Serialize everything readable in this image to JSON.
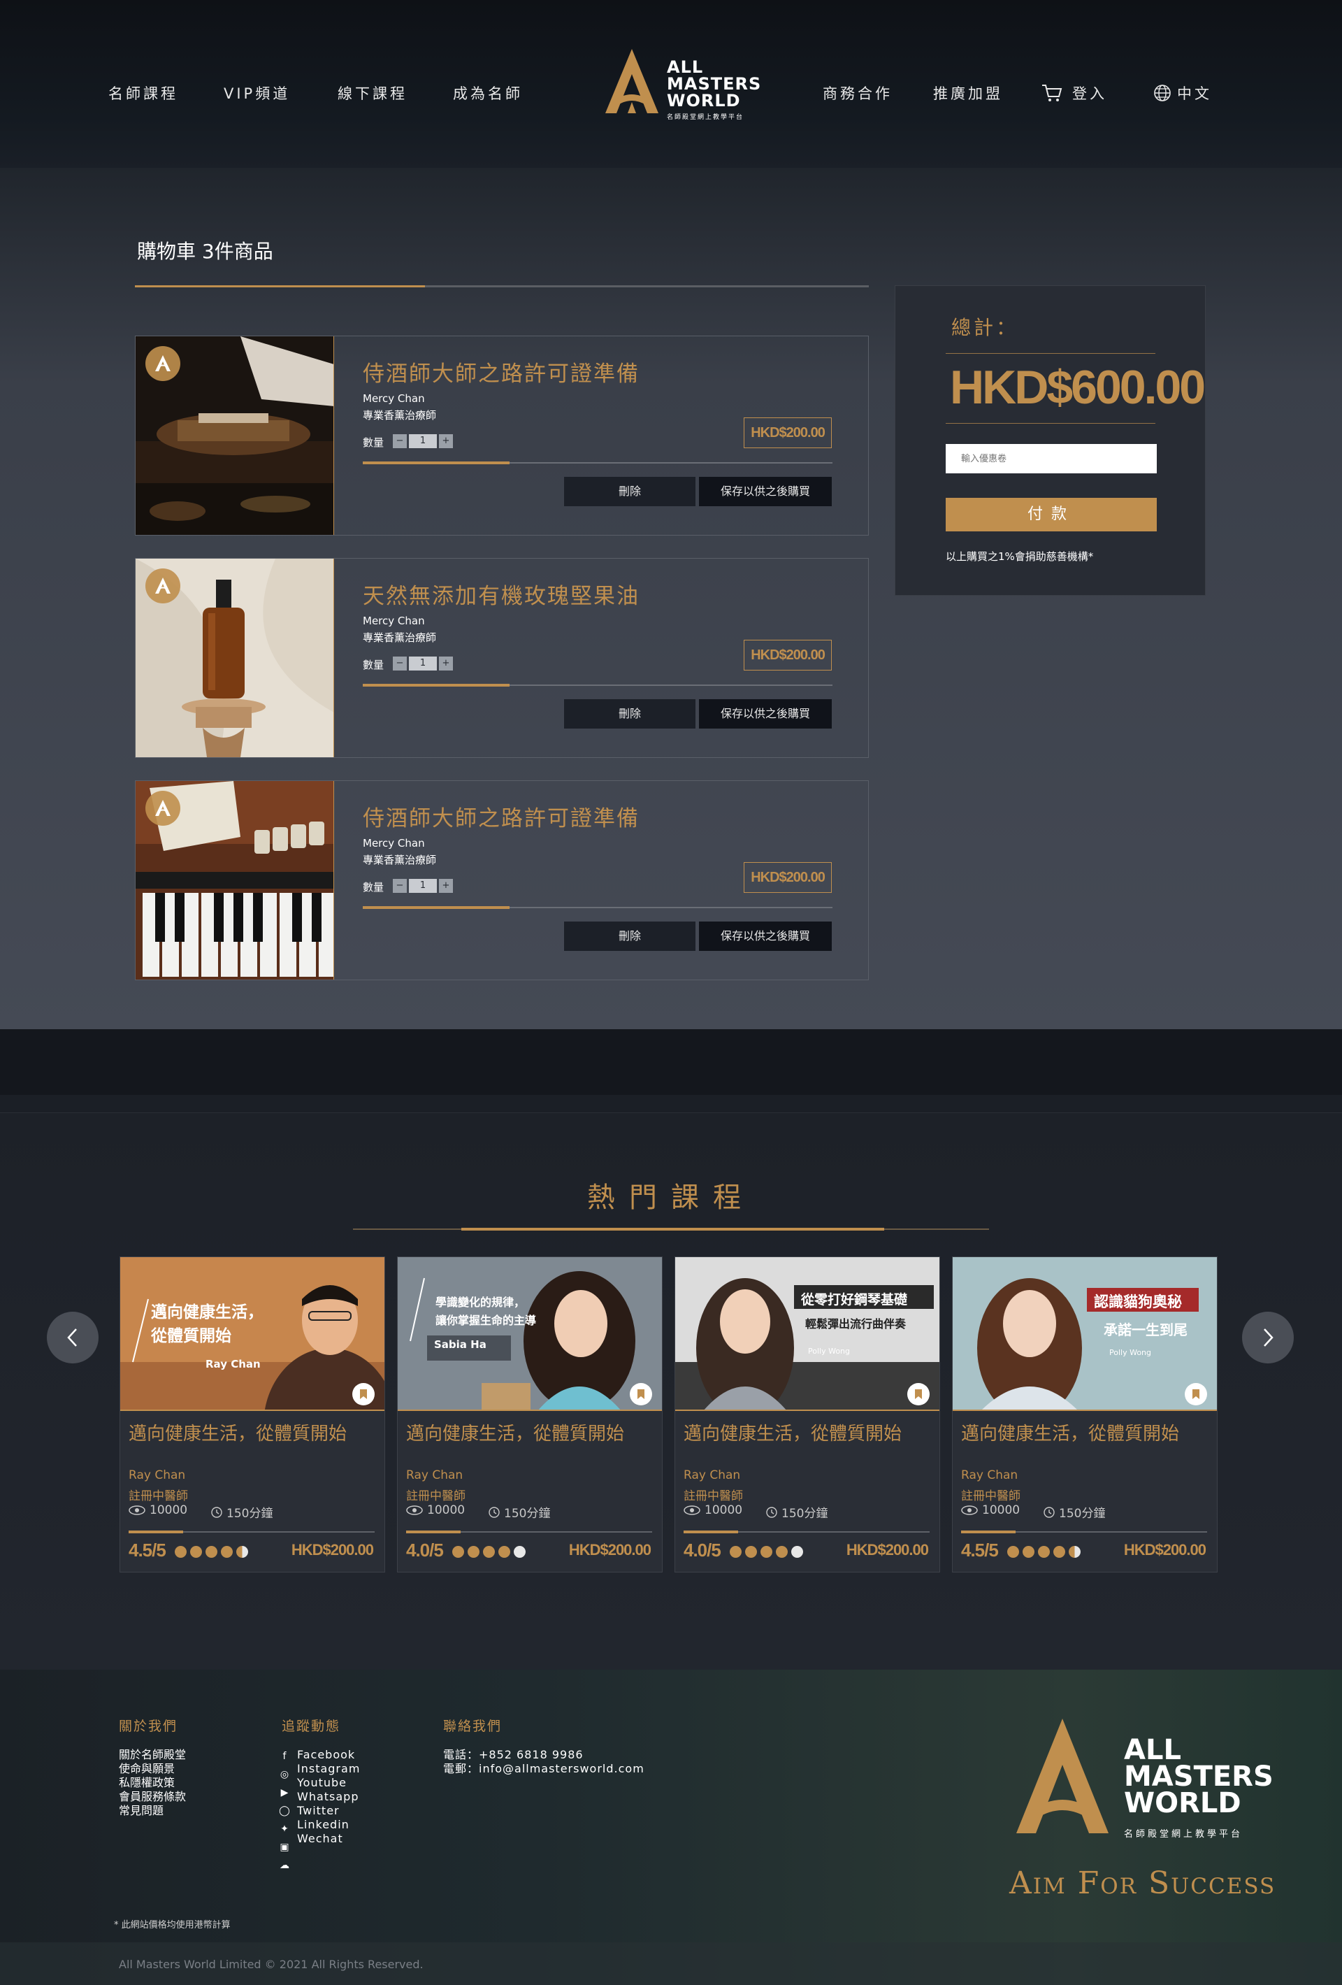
{
  "nav": {
    "left": [
      "名師課程",
      "VIP頻道",
      "線下課程",
      "成為名師"
    ],
    "right": [
      "商務合作",
      "推廣加盟"
    ],
    "login": "登入",
    "language": "中文"
  },
  "logo": {
    "line1": "ALL",
    "line2": "MASTERS",
    "line3": "WORLD",
    "sub": "名師殿堂網上教學平台"
  },
  "cart": {
    "title": "購物車 3件商品",
    "items": [
      {
        "title": "侍酒師大師之路許可證準備",
        "teacher": "Mercy Chan",
        "role": "專業香薰治療師",
        "qty_label": "數量",
        "qty": "1",
        "minus": "−",
        "plus": "+",
        "price": "HKD$200.00",
        "delete": "刪除",
        "save": "保存以供之後購買",
        "image": "chef-plating"
      },
      {
        "title": "天然無添加有機玫瑰堅果油",
        "teacher": "Mercy Chan",
        "role": "專業香薰治療師",
        "qty_label": "數量",
        "qty": "1",
        "minus": "−",
        "plus": "+",
        "price": "HKD$200.00",
        "delete": "刪除",
        "save": "保存以供之後購買",
        "image": "amber-bottle"
      },
      {
        "title": "侍酒師大師之路許可證準備",
        "teacher": "Mercy Chan",
        "role": "專業香薰治療師",
        "qty_label": "數量",
        "qty": "1",
        "minus": "−",
        "plus": "+",
        "price": "HKD$200.00",
        "delete": "刪除",
        "save": "保存以供之後購買",
        "image": "piano-keys"
      }
    ]
  },
  "summary": {
    "label": "總計：",
    "total": "HKD$600.00",
    "coupon_placeholder": "輸入優惠卷",
    "pay": "付款",
    "donate": "以上購買之1%會捐助慈善機構*"
  },
  "popular": {
    "title": "熱門課程",
    "cards": [
      {
        "title": "邁向健康生活，從體質開始",
        "teacher": "Ray Chan",
        "role": "註冊中醫師",
        "views": "10000",
        "duration": "150分鐘",
        "rating": "4.5/5",
        "stars": [
          1,
          1,
          1,
          1,
          0.5
        ],
        "price": "HKD$200.00",
        "img_text1": "邁向健康生活，",
        "img_text2": "從體質開始",
        "img_name": "Ray Chan",
        "bg": "#c5824a"
      },
      {
        "title": "邁向健康生活，從體質開始",
        "teacher": "Ray Chan",
        "role": "註冊中醫師",
        "views": "10000",
        "duration": "150分鐘",
        "rating": "4.0/5",
        "stars": [
          1,
          1,
          1,
          1,
          0
        ],
        "price": "HKD$200.00",
        "img_text1": "學識變化的規律，",
        "img_text2": "讓你掌握生命的主導",
        "img_name": "Sabia Ha",
        "bg": "#7a8590"
      },
      {
        "title": "邁向健康生活，從體質開始",
        "teacher": "Ray Chan",
        "role": "註冊中醫師",
        "views": "10000",
        "duration": "150分鐘",
        "rating": "4.0/5",
        "stars": [
          1,
          1,
          1,
          1,
          0
        ],
        "price": "HKD$200.00",
        "img_text1": "從零打好鋼琴基礎",
        "img_text2": "輕鬆彈出流行曲伴奏",
        "img_name": "Polly Wong",
        "bg": "#d9d9d9"
      },
      {
        "title": "邁向健康生活，從體質開始",
        "teacher": "Ray Chan",
        "role": "註冊中醫師",
        "views": "10000",
        "duration": "150分鐘",
        "rating": "4.5/5",
        "stars": [
          1,
          1,
          1,
          1,
          0.5
        ],
        "price": "HKD$200.00",
        "img_text1": "認識貓狗奧秘",
        "img_text2": "承諾一生到尾",
        "img_name": "Polly Wong",
        "bg": "#9fb7bd"
      }
    ]
  },
  "footer": {
    "about_title": "關於我們",
    "about_links": [
      "關於名師殿堂",
      "使命與願景",
      "私隱權政策",
      "會員服務條款",
      "常見問題"
    ],
    "follow_title": "追蹤動態",
    "follow_links": [
      "Facebook",
      "Instagram",
      "Youtube",
      "Whatsapp",
      "Twitter",
      "Linkedin",
      "Wechat"
    ],
    "contact_title": "聯絡我們",
    "phone": "電話：+852 6818 9986",
    "email": "電郵：info@allmastersworld.com",
    "note": "* 此網站價格均使用港幣計算",
    "copyright": "All Masters World Limited © 2021 All Rights Reserved.",
    "slogan": "Aim For Success"
  },
  "colors": {
    "gold": "#c08f4e",
    "dark": "#14171d",
    "panel": "#282c34"
  }
}
